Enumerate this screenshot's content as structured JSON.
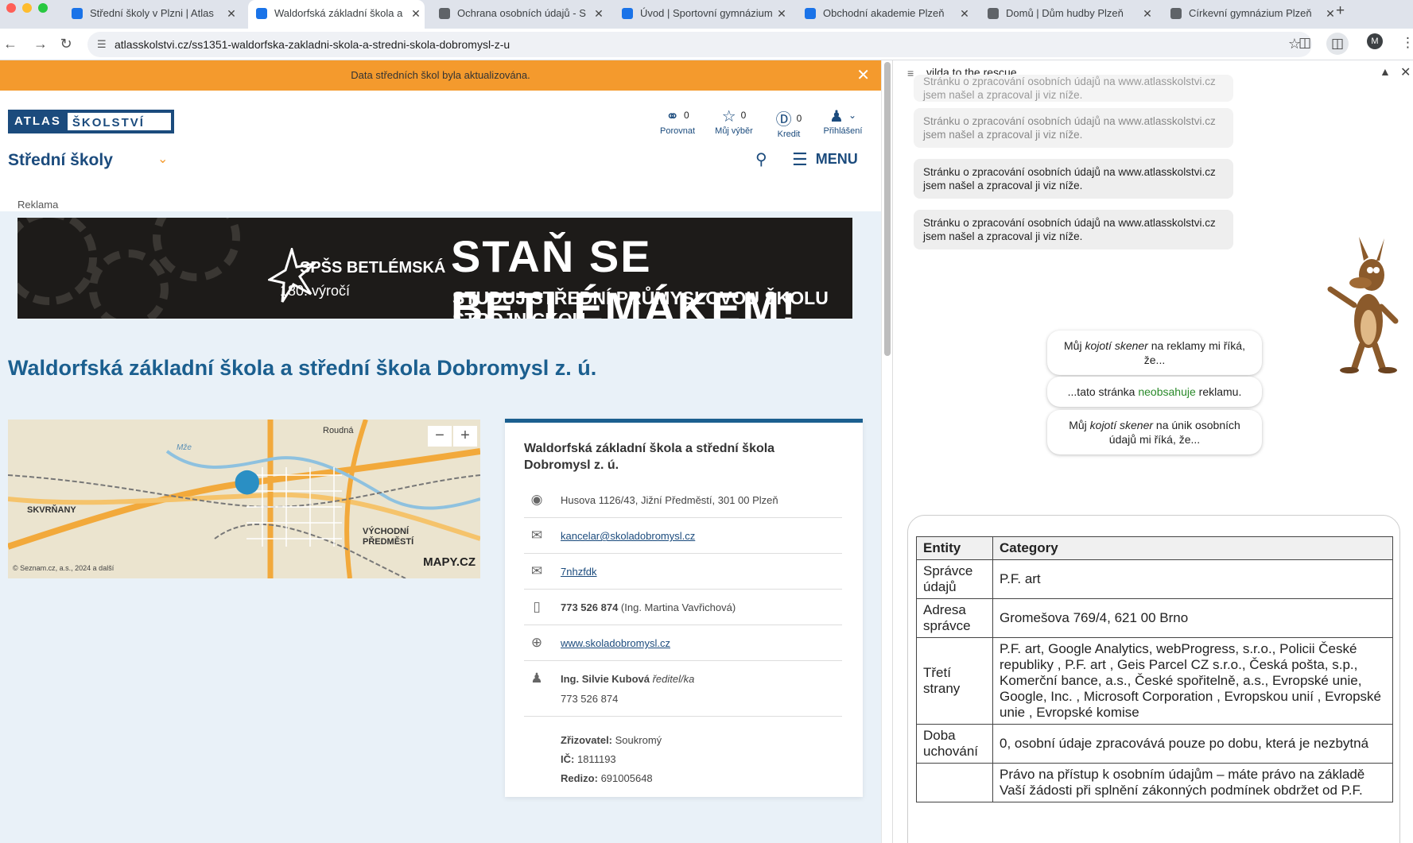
{
  "browser": {
    "tabs": [
      {
        "title": "Střední školy v Plzni | Atlas",
        "active": false,
        "favicon_color": "#1a73e8"
      },
      {
        "title": "Waldorfská základní škola a",
        "active": true,
        "favicon_color": "#1a73e8"
      },
      {
        "title": "Ochrana osobních údajů - S",
        "active": false,
        "favicon_color": "#5f6368"
      },
      {
        "title": "Úvod | Sportovní gymnázium",
        "active": false,
        "favicon_color": "#1a73e8"
      },
      {
        "title": "Obchodní akademie Plzeň",
        "active": false,
        "favicon_color": "#1a73e8"
      },
      {
        "title": "Domů | Dům hudby Plzeň",
        "active": false,
        "favicon_color": "#5f6368"
      },
      {
        "title": "Církevní gymnázium Plzeň",
        "active": false,
        "favicon_color": "#5f6368"
      }
    ],
    "url": "atlasskolstvi.cz/ss1351-waldorfska-zakladni-skola-a-stredni-skola-dobromysl-z-u",
    "avatar_letter": "M"
  },
  "site": {
    "notice": "Data středních škol byla aktualizována.",
    "logo_left": "ATLAS",
    "logo_right": "ŠKOLSTVÍ",
    "header_items": [
      {
        "label": "Porovnat",
        "count": "0",
        "icon": "compare-icon"
      },
      {
        "label": "Můj výběr",
        "count": "0",
        "icon": "star-icon"
      },
      {
        "label": "Kredit",
        "count": "0",
        "icon": "credit-icon"
      },
      {
        "label": "Přihlášení",
        "count": "",
        "icon": "user-login-icon"
      }
    ],
    "section": "Střední školy",
    "menu_label": "MENU",
    "ad_label": "Reklama",
    "ad": {
      "school": "SPŠS BETLÉMSKÁ",
      "anniversary": "180. výročí",
      "headline": "STAŇ SE BETLÉMÁKEM!",
      "subline": "STUDUJ STŘEDNÍ PRŮMYSLOVOU ŠKOLU STROJNICKOU"
    },
    "school_title": "Waldorfská základní škola a střední škola Dobromysl z. ú.",
    "map": {
      "labels": [
        "Roudná",
        "SKVRŇANY",
        "VÝCHODNÍ PŘEDMĚSTÍ",
        "Mže"
      ],
      "copyright": "© Seznam.cz, a.s., 2024 a další",
      "brand": "MAPY.CZ"
    },
    "card": {
      "title": "Waldorfská základní škola a střední škola Dobromysl z. ú.",
      "address": "Husova 1126/43, Jižní Předměstí, 301 00 Plzeň",
      "email": "kancelar@skoladobromysl.cz",
      "databox": "7nhzfdk",
      "phone": "773 526 874",
      "phone_contact": "(Ing. Martina Vavřichová)",
      "web": "www.skoladobromysl.cz",
      "director_name": "Ing. Silvie Kubová",
      "director_role": "ředitel/ka",
      "director_phone": "773 526 874",
      "founder_label": "Zřizovatel:",
      "founder": "Soukromý",
      "ic_label": "IČ:",
      "ic": "1811193",
      "redizo_label": "Redizo:",
      "redizo": "691005648"
    }
  },
  "panel": {
    "title": "vilda to the rescue",
    "messages": [
      "Stránku o zpracování osobních údajů na www.atlasskolstvi.cz jsem našel a zpracoval ji viz níže.",
      "Stránku o zpracování osobních údajů na www.atlasskolstvi.cz jsem našel a zpracoval ji viz níže.",
      "Stránku o zpracování osobních údajů na www.atlasskolstvi.cz jsem našel a zpracoval ji viz níže.",
      "Stránku o zpracování osobních údajů na www.atlasskolstvi.cz jsem našel a zpracoval ji viz níže."
    ],
    "bubble1_pre": "Můj ",
    "bubble1_em": "kojotí skener",
    "bubble1_post": " na reklamy mi říká, že...",
    "bubble2_pre": "...tato stránka ",
    "bubble2_green": "neobsahuje",
    "bubble2_post": " reklamu.",
    "bubble3_pre": "Můj ",
    "bubble3_em": "kojotí skener",
    "bubble3_post": " na únik osobních údajů mi říká, že...",
    "table": {
      "headers": [
        "Entity",
        "Category"
      ],
      "rows": [
        [
          "Správce údajů",
          "P.F. art"
        ],
        [
          "Adresa správce",
          "Gromešova 769/4, 621 00 Brno"
        ],
        [
          "Třetí strany",
          "P.F. art, Google Analytics, webProgress, s.r.o., Policii České republiky , P.F. art , Geis Parcel CZ s.r.o., Česká pošta, s.p., Komerční bance, a.s., České spořitelně, a.s., Evropské unie, Google, Inc. , Microsoft Corporation , Evropskou unií , Evropské unie , Evropské komise"
        ],
        [
          "Doba uchování",
          "0, osobní údaje zpracovává pouze po dobu, která je nezbytná"
        ],
        [
          "",
          "Právo na přístup k osobním údajům – máte právo na základě Vaší žádosti při splnění zákonných podmínek obdržet od P.F."
        ]
      ]
    }
  },
  "colors": {
    "accent_orange": "#f49a2d",
    "brand_blue": "#1b4b7d",
    "title_blue": "#1b5f8f"
  }
}
